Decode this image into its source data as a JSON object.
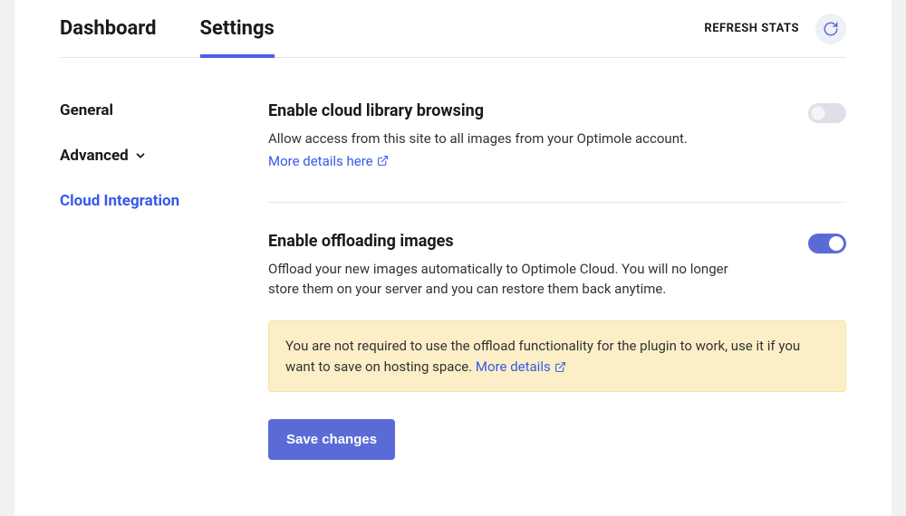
{
  "tabs": {
    "dashboard": "Dashboard",
    "settings": "Settings"
  },
  "topbar": {
    "refresh_label": "REFRESH STATS"
  },
  "sidebar": {
    "general": "General",
    "advanced": "Advanced",
    "cloud_integration": "Cloud Integration"
  },
  "section1": {
    "title": "Enable cloud library browsing",
    "desc": "Allow access from this site to all images from your Optimole account.",
    "link": "More details here",
    "toggle": false
  },
  "section2": {
    "title": "Enable offloading images",
    "desc": "Offload your new images automatically to Optimole Cloud. You will no longer store them on your server and you can restore them back anytime.",
    "toggle": true
  },
  "notice": {
    "text": "You are not required to use the offload functionality for the plugin to work, use it if you want to save on hosting space. ",
    "link": "More details"
  },
  "save_label": "Save changes"
}
